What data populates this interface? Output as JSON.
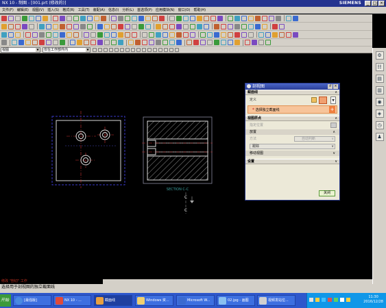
{
  "window": {
    "title": "NX 10 - 制图 - [001.prt (修改的)]",
    "brand": "SIEMENS"
  },
  "menu": [
    "文件(F)",
    "编辑(E)",
    "视图(V)",
    "插入(S)",
    "格式(R)",
    "工具(T)",
    "装配(A)",
    "信息(I)",
    "分析(L)",
    "首选项(P)",
    "应用模块(N)",
    "窗口(O)",
    "帮助(H)"
  ],
  "selection_bar": {
    "filter": "视图",
    "scope": "仅在工作部件内"
  },
  "drawing": {
    "section_label": "SECTION C-C",
    "section_letter_top": "C",
    "section_letter_bottom": "C"
  },
  "dialog": {
    "title": "剖视图",
    "sections": {
      "section_line": "截面线",
      "define_label": "定义",
      "hint": "选择独立截面线",
      "view_origin": "视图原点",
      "specify_location": "指定位置",
      "placement": "放置",
      "method_label": "方法",
      "method_value": "自动判断",
      "alignment_value": "跟踪",
      "move_view": "移动视图",
      "settings": "设置"
    },
    "close_button": "关闭"
  },
  "status_bar": {
    "message": "选择用于剖视图的独立截面线",
    "tip": "修改 \"剖切\" 工作"
  },
  "taskbar": {
    "start": "开始",
    "tasks": [
      "[最强版]",
      "NX 10 - ...",
      "截面线",
      "Windows 资...",
      "Microsoft W...",
      "02.jpg - 画图",
      "视频发站位..."
    ],
    "time": "11:30",
    "date": "2016/12/28"
  },
  "colors": {
    "titlebar": "#24338f",
    "chrome": "#d4d0c8",
    "canvas": "#000000",
    "dialog_accent": "#f0a070",
    "taskbar": "#2e57cc"
  }
}
